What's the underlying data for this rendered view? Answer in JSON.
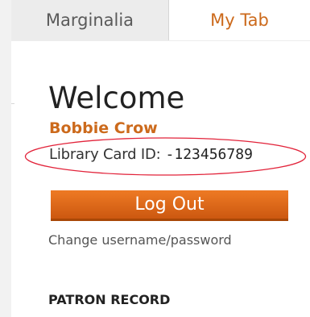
{
  "tabs": [
    {
      "label": "Marginalia",
      "active": false
    },
    {
      "label": "My Tab",
      "active": true
    }
  ],
  "account": {
    "heading": "Welcome",
    "user_name": "Bobbie Crow",
    "card_label": "Library Card ID:",
    "card_id": "-123456789",
    "logout_label": "Log Out",
    "change_link": "Change username/password"
  },
  "sections": {
    "patron_record": "PATRON RECORD"
  },
  "annotation": {
    "shape": "ellipse",
    "color": "#e2233a"
  },
  "colors": {
    "accent": "#cc6a1c",
    "button_top": "#ee7a24",
    "button_bottom": "#cc5810",
    "page_background": "#f2f2f2"
  }
}
